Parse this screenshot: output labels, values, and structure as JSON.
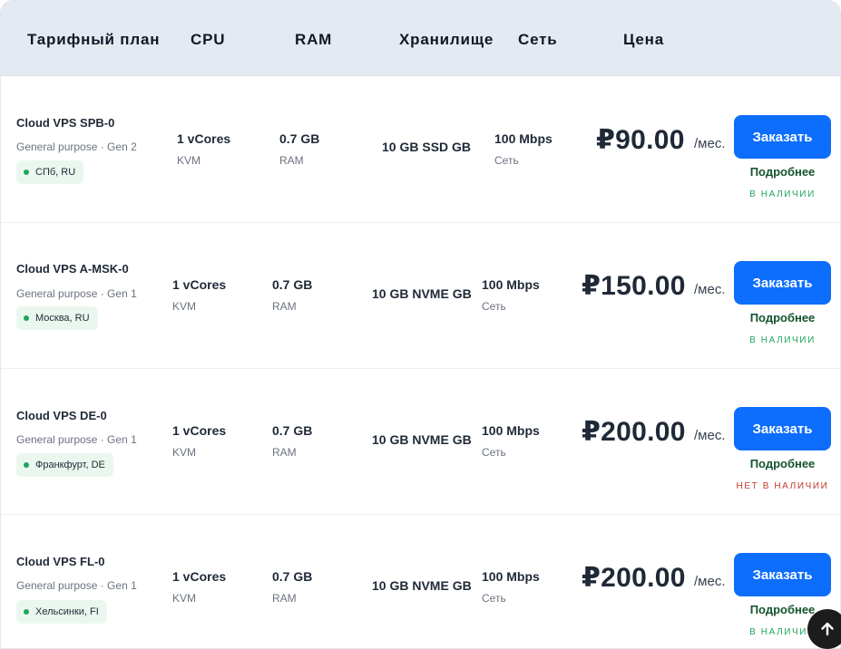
{
  "header": {
    "plan": "Тарифный план",
    "cpu": "CPU",
    "ram": "RAM",
    "storage": "Хранилище",
    "network": "Сеть",
    "price": "Цена"
  },
  "plans": [
    {
      "name": "Cloud VPS SPB-0",
      "subtitle": "General purpose · Gen 2",
      "location": "СПб, RU",
      "cpu": "1 vCores",
      "cpu_caption": "KVM",
      "ram": "0.7 GB",
      "ram_caption": "RAM",
      "storage": "10 GB SSD GB",
      "network": "100 Mbps",
      "network_caption": "Сеть",
      "price": "₽90.00",
      "period": "/мес.",
      "order_label": "Заказать",
      "more_label": "Подробнее",
      "availability": "В НАЛИЧИИ"
    },
    {
      "name": "Cloud VPS A-MSK-0",
      "subtitle": "General purpose · Gen 1",
      "location": "Москва, RU",
      "cpu": "1 vCores",
      "cpu_caption": "KVM",
      "ram": "0.7 GB",
      "ram_caption": "RAM",
      "storage": "10 GB NVME GB",
      "network": "100 Mbps",
      "network_caption": "Сеть",
      "price": "₽150.00",
      "period": "/мес.",
      "order_label": "Заказать",
      "more_label": "Подробнее",
      "availability": "В НАЛИЧИИ"
    },
    {
      "name": "Cloud VPS DE-0",
      "subtitle": "General purpose · Gen 1",
      "location": "Франкфурт, DE",
      "cpu": "1 vCores",
      "cpu_caption": "KVM",
      "ram": "0.7 GB",
      "ram_caption": "RAM",
      "storage": "10 GB NVME GB",
      "network": "100 Mbps",
      "network_caption": "Сеть",
      "price": "₽200.00",
      "period": "/мес.",
      "order_label": "Заказать",
      "more_label": "Подробнее",
      "availability": "НЕТ В НАЛИЧИИ"
    },
    {
      "name": "Cloud VPS FL-0",
      "subtitle": "General purpose · Gen 1",
      "location": "Хельсинки, FI",
      "cpu": "1 vCores",
      "cpu_caption": "KVM",
      "ram": "0.7 GB",
      "ram_caption": "RAM",
      "storage": "10 GB NVME GB",
      "network": "100 Mbps",
      "network_caption": "Сеть",
      "price": "₽200.00",
      "period": "/мес.",
      "order_label": "Заказать",
      "more_label": "Подробнее",
      "availability": "В НАЛИЧИИ"
    }
  ],
  "colors": {
    "accent": "#0d6efd",
    "header_bg": "#e3eaf2",
    "in_stock": "#22a45d",
    "out_of_stock": "#c0392b"
  },
  "icons": {
    "scroll_top": "arrow-up-icon",
    "location": "location-dot-icon"
  }
}
